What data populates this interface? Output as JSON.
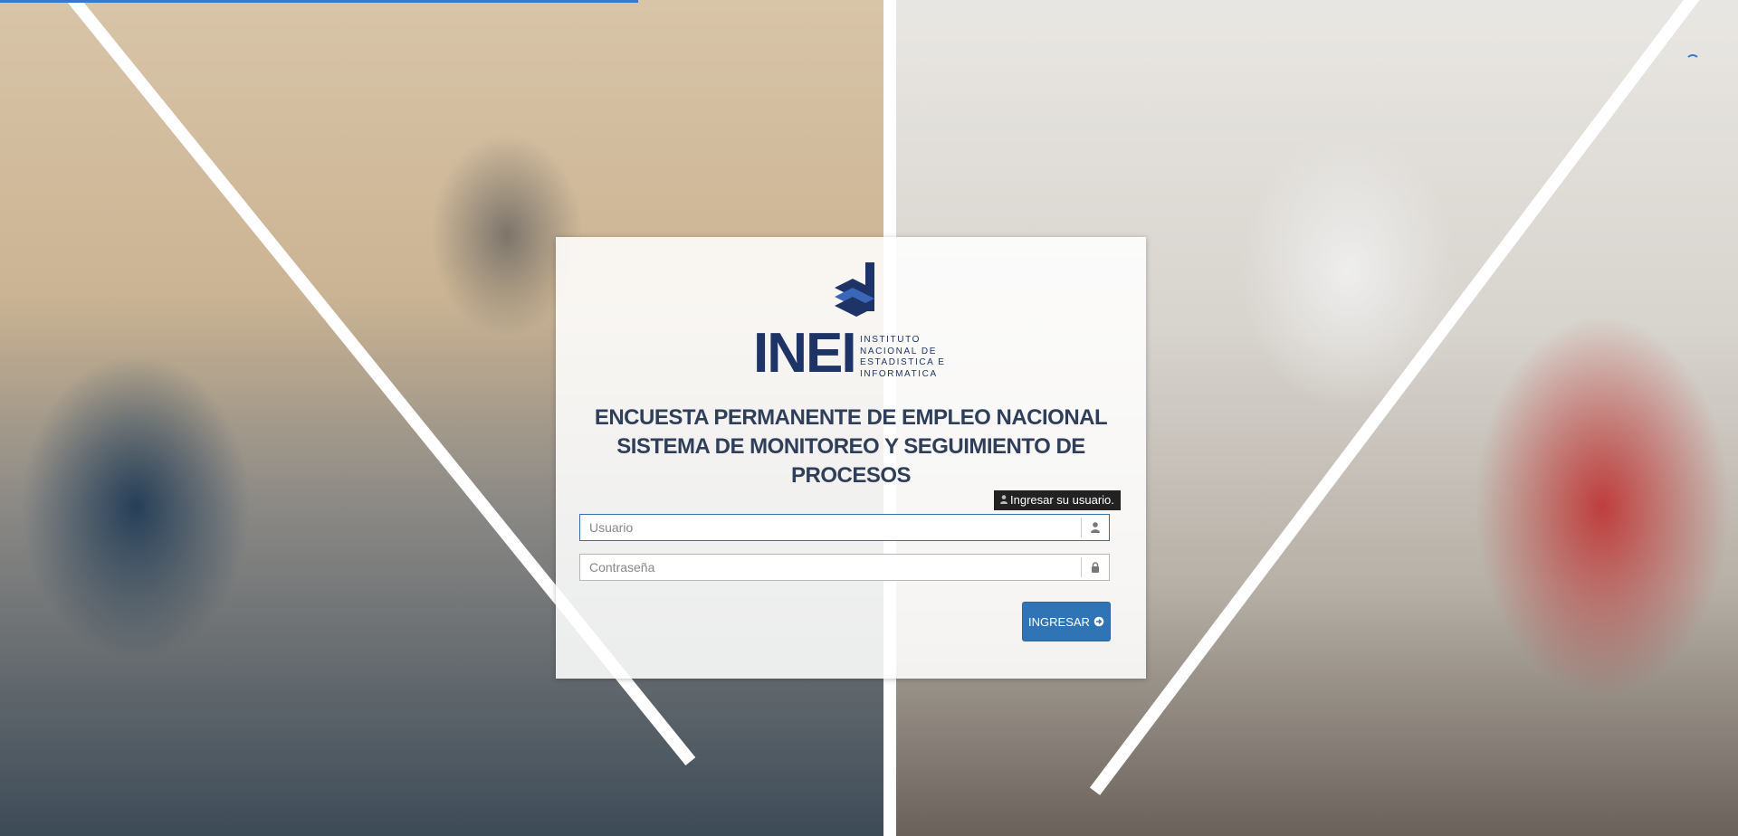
{
  "logo": {
    "wordmark": "INEI",
    "subtitle_lines": [
      "INSTITUTO",
      "NACIONAL DE",
      "ESTADISTICA E",
      "INFORMATICA"
    ]
  },
  "title_lines": [
    "ENCUESTA PERMANENTE DE EMPLEO NACIONAL",
    "SISTEMA DE MONITOREO Y SEGUIMIENTO DE",
    "PROCESOS"
  ],
  "tooltip": {
    "text": "Ingresar su usuario.",
    "icon": "user-icon"
  },
  "username": {
    "placeholder": "Usuario",
    "value": "",
    "icon": "user-icon"
  },
  "password": {
    "placeholder": "Contraseña",
    "value": "",
    "icon": "lock-icon"
  },
  "submit": {
    "label": "INGRESAR",
    "icon": "arrow-circle-right-icon"
  },
  "colors": {
    "brand_navy": "#1f3466",
    "button_blue": "#2f75b5",
    "title_text": "#2f3f5a"
  }
}
